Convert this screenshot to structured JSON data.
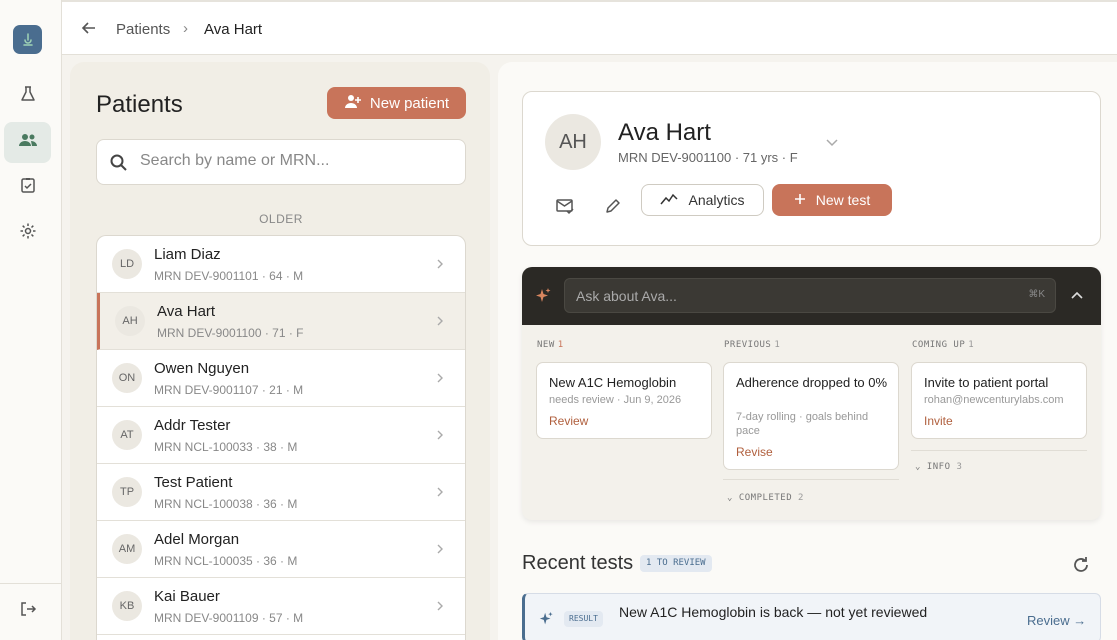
{
  "breadcrumb": {
    "root": "Patients",
    "separator": "›",
    "current": "Ava Hart"
  },
  "list": {
    "title": "Patients",
    "new_patient_label": "New patient",
    "search_placeholder": "Search by name or MRN...",
    "section_label": "OLDER",
    "patients": [
      {
        "initials": "LD",
        "name": "Liam Diaz",
        "meta": "MRN DEV-9001101 · 64 · M"
      },
      {
        "initials": "AH",
        "name": "Ava Hart",
        "meta": "MRN DEV-9001100 · 71 · F"
      },
      {
        "initials": "ON",
        "name": "Owen Nguyen",
        "meta": "MRN DEV-9001107 · 21 · M"
      },
      {
        "initials": "AT",
        "name": "Addr Tester",
        "meta": "MRN NCL-100033 · 38 · M"
      },
      {
        "initials": "TP",
        "name": "Test Patient",
        "meta": "MRN NCL-100038 · 36 · M"
      },
      {
        "initials": "AM",
        "name": "Adel Morgan",
        "meta": "MRN NCL-100035 · 36 · M"
      },
      {
        "initials": "KB",
        "name": "Kai Bauer",
        "meta": "MRN DEV-9001109 · 57 · M"
      }
    ]
  },
  "patient": {
    "initials": "AH",
    "name": "Ava Hart",
    "meta": "MRN DEV-9001100  ·  71 yrs  ·  F",
    "analytics_label": "Analytics",
    "new_test_label": "New test"
  },
  "ask": {
    "placeholder": "Ask about Ava...",
    "shortcut": "⌘K",
    "columns": {
      "new": {
        "label": "NEW",
        "count": "1"
      },
      "previous": {
        "label": "PREVIOUS",
        "count": "1"
      },
      "upcoming": {
        "label": "COMING UP",
        "count": "1"
      }
    },
    "cards": {
      "new": {
        "title": "New A1C Hemoglobin",
        "sub": "needs review · Jun 9, 2026",
        "action": "Review"
      },
      "previous": {
        "title": "Adherence dropped to 0%",
        "sub": "7-day rolling · goals behind pace",
        "action": "Revise"
      },
      "upcoming": {
        "title": "Invite to patient portal",
        "sub": "rohan@newcenturylabs.com",
        "action": "Invite"
      }
    },
    "completed": {
      "label": "COMPLETED",
      "count": "2"
    },
    "info": {
      "label": "INFO",
      "count": "3"
    }
  },
  "recent": {
    "title": "Recent tests",
    "badge": "1 TO REVIEW",
    "item": {
      "tag": "RESULT",
      "text": "New A1C Hemoglobin is back — not yet reviewed",
      "action": "Review →"
    }
  },
  "colors": {
    "accent": "#c8745a",
    "brand": "#4a6d8f",
    "ask_bar": "#2b2925"
  }
}
